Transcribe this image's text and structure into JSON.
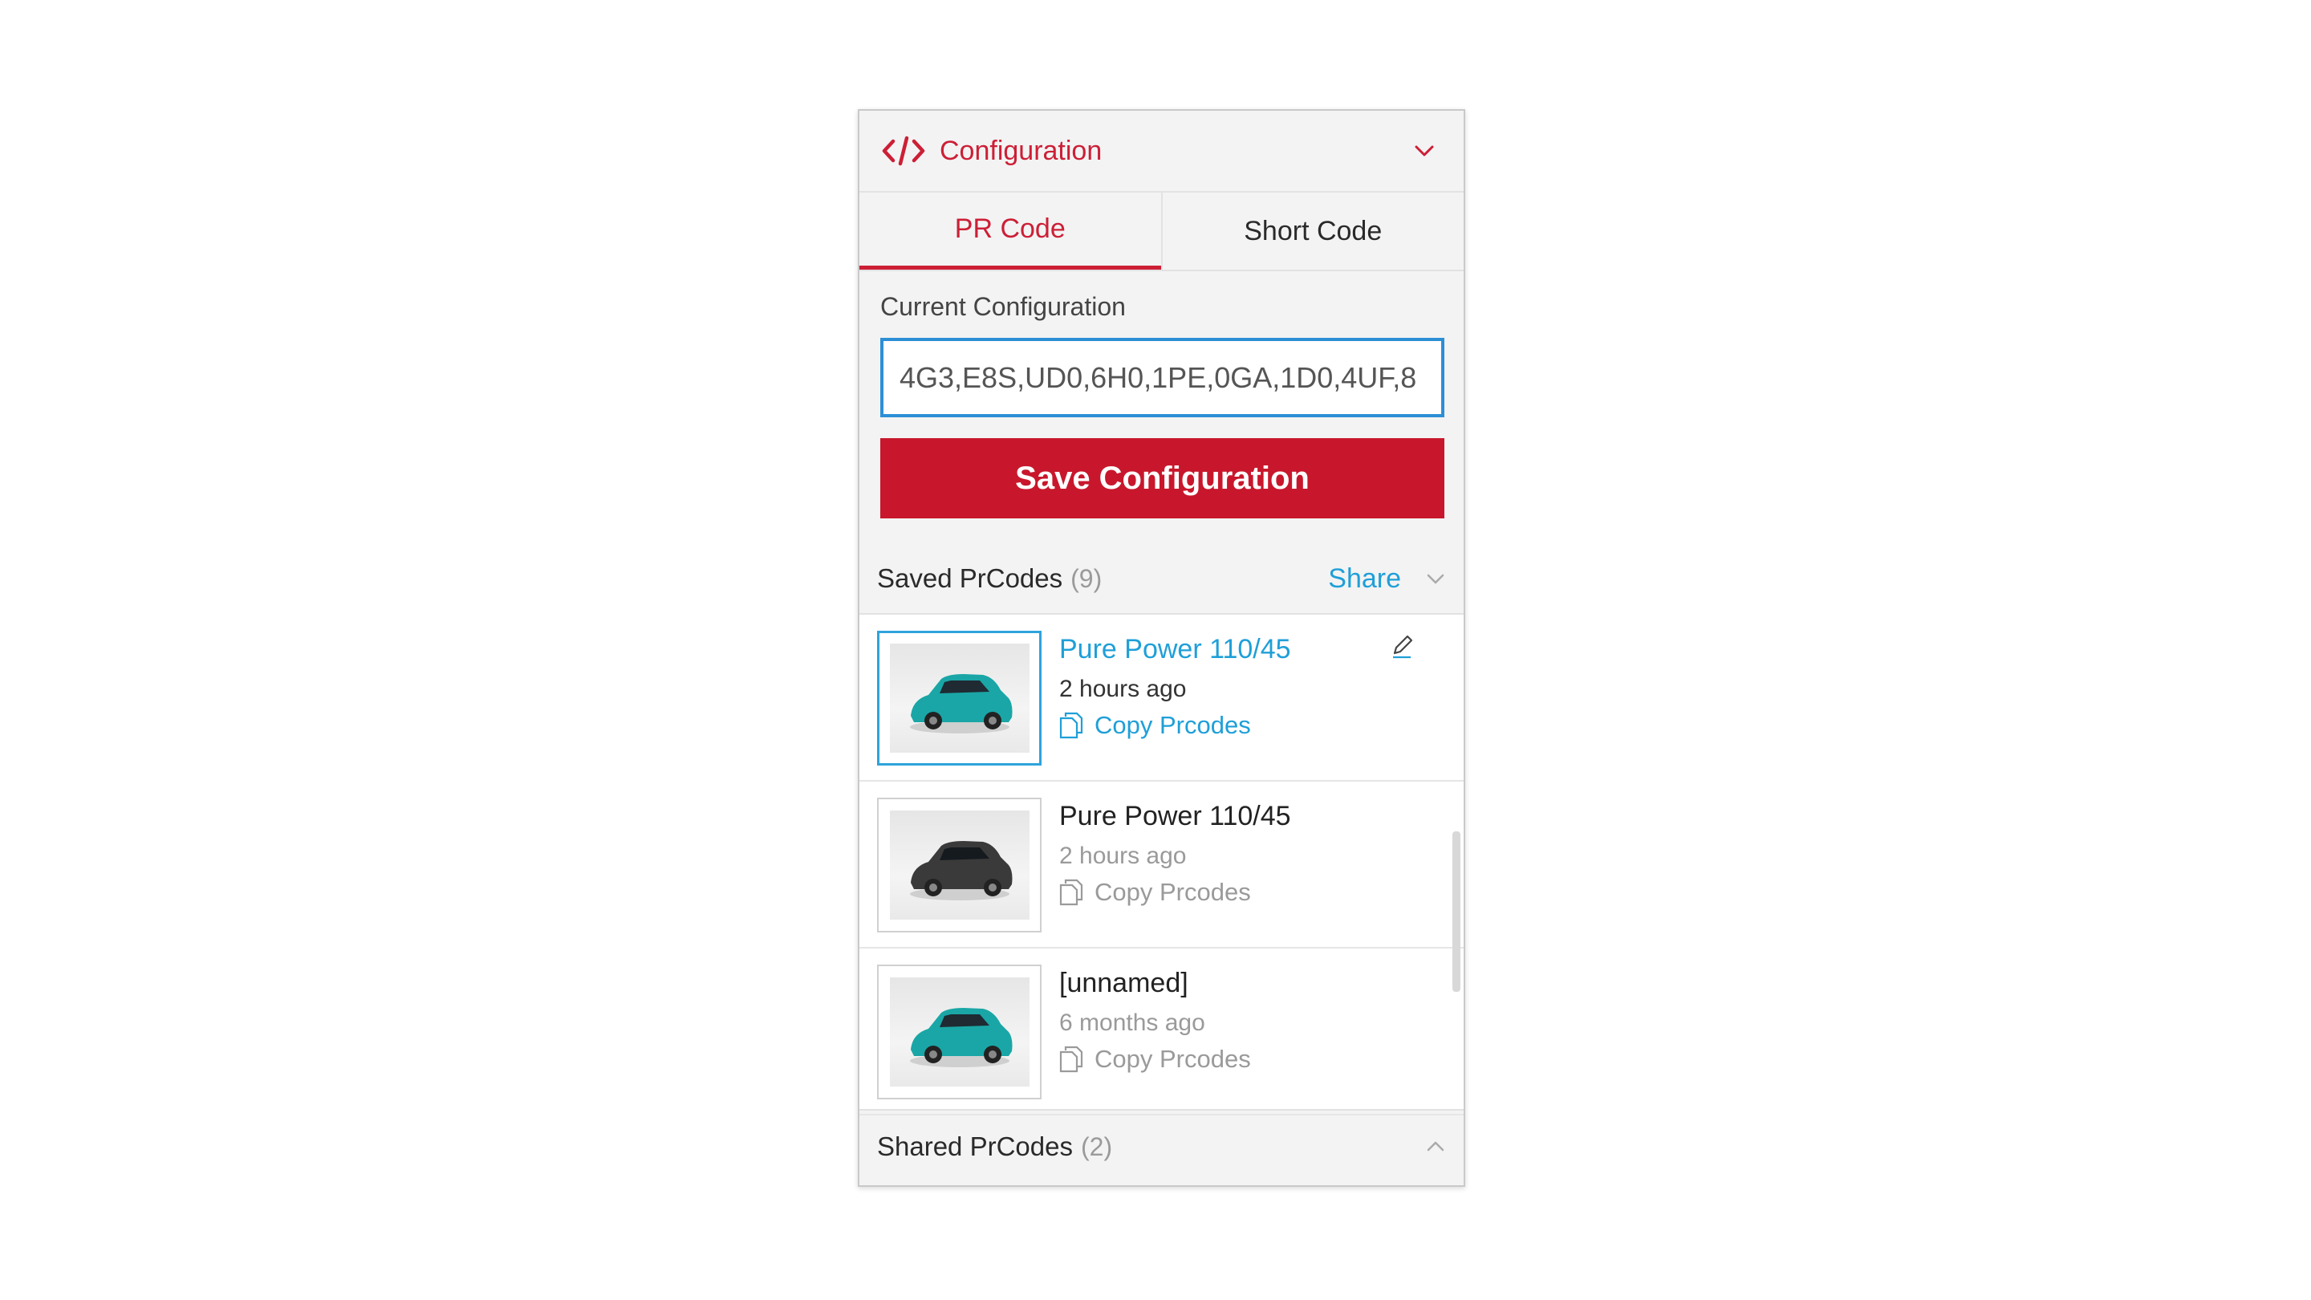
{
  "panel": {
    "title": "Configuration",
    "icon": "code-icon",
    "collapse_icon": "chevron-down-icon"
  },
  "tabs": [
    {
      "label": "PR Code",
      "active": true
    },
    {
      "label": "Short Code",
      "active": false
    }
  ],
  "current": {
    "label": "Current Configuration",
    "value": "4G3,E8S,UD0,6H0,1PE,0GA,1D0,4UF,8"
  },
  "save_button": "Save Configuration",
  "saved": {
    "label": "Saved PrCodes",
    "count": "(9)",
    "share": "Share",
    "items": [
      {
        "title": "Pure Power 110/45",
        "time": "2 hours ago",
        "copy": "Copy Prcodes",
        "car_color": "#1aa6a6",
        "selected": true
      },
      {
        "title": "Pure Power 110/45",
        "time": "2 hours ago",
        "copy": "Copy Prcodes",
        "car_color": "#3a3a3a",
        "selected": false
      },
      {
        "title": "[unnamed]",
        "time": "6 months ago",
        "copy": "Copy Prcodes",
        "car_color": "#1aa6a6",
        "selected": false
      }
    ]
  },
  "shared": {
    "label": "Shared PrCodes",
    "count": "(2)"
  },
  "colors": {
    "brand_red": "#c8172c",
    "link_blue": "#1f9fd8",
    "input_border": "#2c8fd6"
  }
}
